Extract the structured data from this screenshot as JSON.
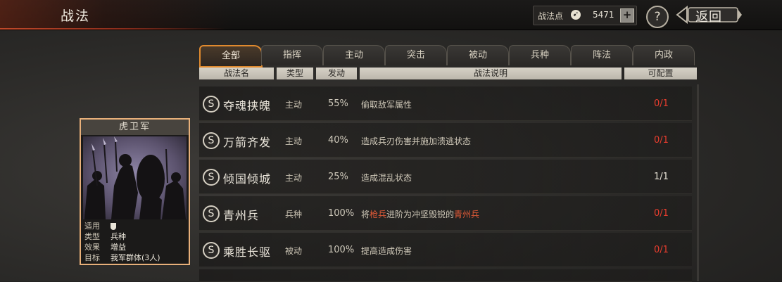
{
  "header": {
    "title": "战法",
    "points_label": "战法点",
    "points_icon": "compass-icon",
    "points_value": "5471",
    "plus_label": "+",
    "help_label": "?",
    "back_label": "返回"
  },
  "tabs": [
    {
      "label": "全部",
      "active": true
    },
    {
      "label": "指挥",
      "active": false
    },
    {
      "label": "主动",
      "active": false
    },
    {
      "label": "突击",
      "active": false
    },
    {
      "label": "被动",
      "active": false
    },
    {
      "label": "兵种",
      "active": false
    },
    {
      "label": "阵法",
      "active": false
    },
    {
      "label": "内政",
      "active": false
    }
  ],
  "columns": [
    "战法名",
    "类型",
    "发动",
    "战法说明",
    "可配置"
  ],
  "tactics": [
    {
      "grade": "S",
      "name": "夺魂挟魄",
      "type": "主动",
      "rate": "55%",
      "desc_parts": [
        "偷取敌军属性"
      ],
      "config": "0/1",
      "config_ok": false
    },
    {
      "grade": "S",
      "name": "万箭齐发",
      "type": "主动",
      "rate": "40%",
      "desc_parts": [
        "造成兵刃伤害并施加溃逃状态"
      ],
      "config": "0/1",
      "config_ok": false
    },
    {
      "grade": "S",
      "name": "倾国倾城",
      "type": "主动",
      "rate": "25%",
      "desc_parts": [
        "造成混乱状态"
      ],
      "config": "1/1",
      "config_ok": true
    },
    {
      "grade": "S",
      "name": "青州兵",
      "type": "兵种",
      "rate": "100%",
      "desc_parts": [
        "将",
        "枪兵",
        "进阶为冲坚毁锐的",
        "青州兵"
      ],
      "config": "0/1",
      "config_ok": false
    },
    {
      "grade": "S",
      "name": "乘胜长驱",
      "type": "被动",
      "rate": "100%",
      "desc_parts": [
        "提高造成伤害"
      ],
      "config": "0/1",
      "config_ok": false
    }
  ],
  "card": {
    "title": "虎卫军",
    "rows": [
      {
        "key": "适用",
        "value": "",
        "icon": "shield-icon"
      },
      {
        "key": "类型",
        "value": "兵种"
      },
      {
        "key": "效果",
        "value": "增益"
      },
      {
        "key": "目标",
        "value": "我军群体(3人)"
      }
    ]
  },
  "colors": {
    "accent": "#e08a2e",
    "unavailable": "#e83d2e",
    "highlight": "#e05a38"
  }
}
